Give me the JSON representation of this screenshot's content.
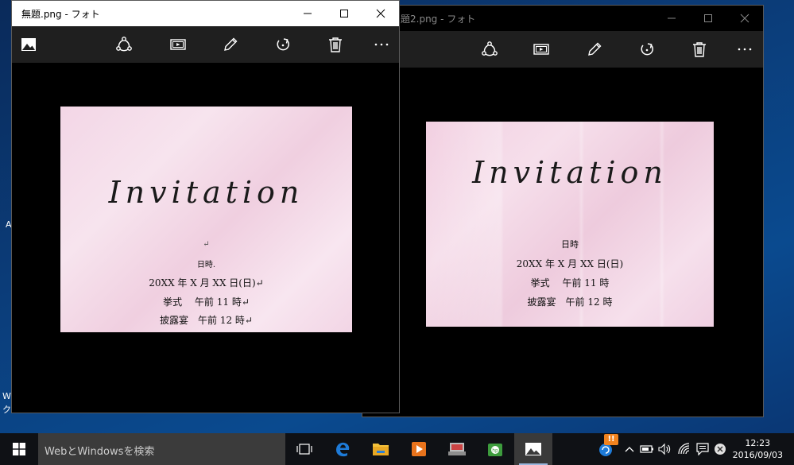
{
  "desktop": {
    "fragment_a": "A",
    "fragment_w": "W",
    "fragment_g": "ク"
  },
  "window_front": {
    "title": "無題.png - フォト",
    "card": {
      "script_title": "Invitation",
      "return_mark": "↵",
      "lines": [
        "日時.",
        "20XX 年 X 月 XX 日(日)↵",
        "挙式　 午前 11 時↵",
        "披露宴　午前 12 時↵"
      ]
    }
  },
  "window_back": {
    "title": "題2.png - フォト",
    "card": {
      "script_title": "Invitation",
      "lines": [
        "日時",
        "20XX 年 X 月 XX 日(日)",
        "挙式　 午前 11 時",
        "披露宴　午前 12 時"
      ]
    }
  },
  "taskbar": {
    "search_placeholder": "WebとWindowsを検索",
    "notification_badge": "!!",
    "clock_time": "12:23",
    "clock_date": "2016/09/03"
  },
  "colors": {
    "accent": "#0a74da",
    "edge_blue": "#1e7bd8",
    "explorer_yellow": "#f3c13a",
    "store_green": "#3d9c3d"
  },
  "icons": [
    "start-icon",
    "task-view-icon",
    "edge-icon",
    "file-explorer-icon",
    "media-player-icon",
    "app-icon",
    "hp-icon",
    "photos-icon"
  ]
}
